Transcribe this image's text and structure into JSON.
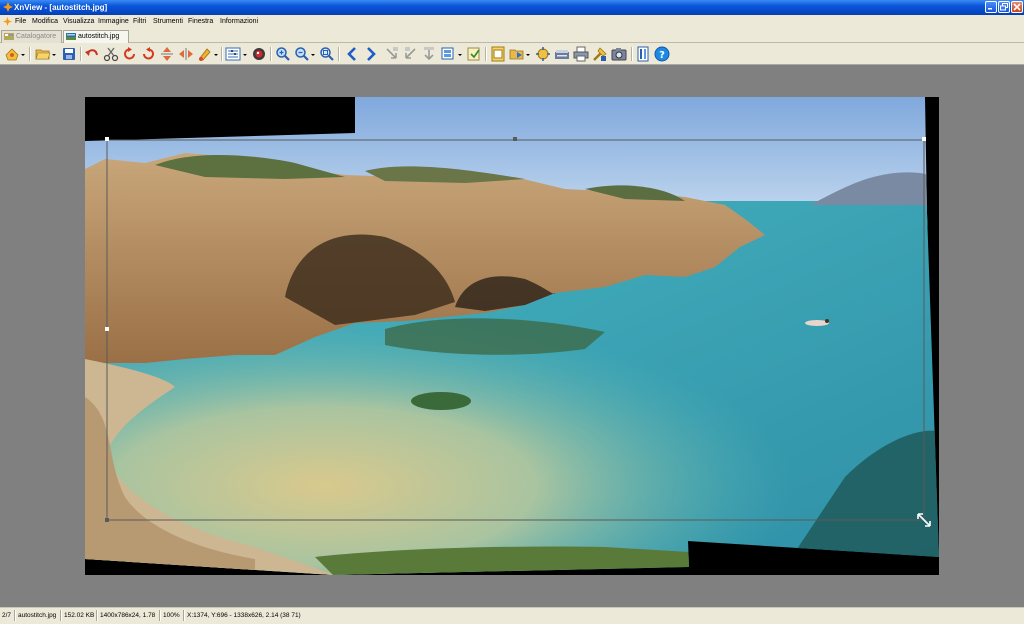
{
  "window": {
    "title": "XnView - [autostitch.jpg]"
  },
  "menu": {
    "items": [
      "File",
      "Modifica",
      "Visualizza",
      "Immagine",
      "Filtri",
      "Strumenti",
      "Finestra",
      "Informazioni"
    ]
  },
  "tabs": [
    {
      "label": "Catalogatore",
      "active": false
    },
    {
      "label": "autostitch.jpg",
      "active": true
    }
  ],
  "toolbar": {
    "buttons": [
      "browser-icon",
      "open-folder-icon",
      "save-icon",
      "undo-icon",
      "cut-icon",
      "rotate-left-icon",
      "rotate-right-icon",
      "flip-vertical-icon",
      "flip-horizontal-icon",
      "paint-icon",
      "adjust-icon",
      "color-icon",
      "zoom-in-icon",
      "zoom-out-icon",
      "zoom-fit-icon",
      "previous-icon",
      "next-icon",
      "first-icon",
      "last-icon",
      "copy-icon",
      "slideshow-icon",
      "acquire-icon",
      "print-icon",
      "tools-icon",
      "settings-icon",
      "help-icon"
    ]
  },
  "colors": {
    "accent": "#0a55d9",
    "viewer_bg": "#808080",
    "help": "#1e88e5"
  },
  "statusbar": {
    "index": "2/7",
    "filename": "autostitch.jpg",
    "filesize": "152.02 KB",
    "dimensions": "1400x786x24, 1.78",
    "zoom": "100%",
    "coords": "X:1374, Y:696 - 1338x626, 2.14 (38 71)"
  }
}
